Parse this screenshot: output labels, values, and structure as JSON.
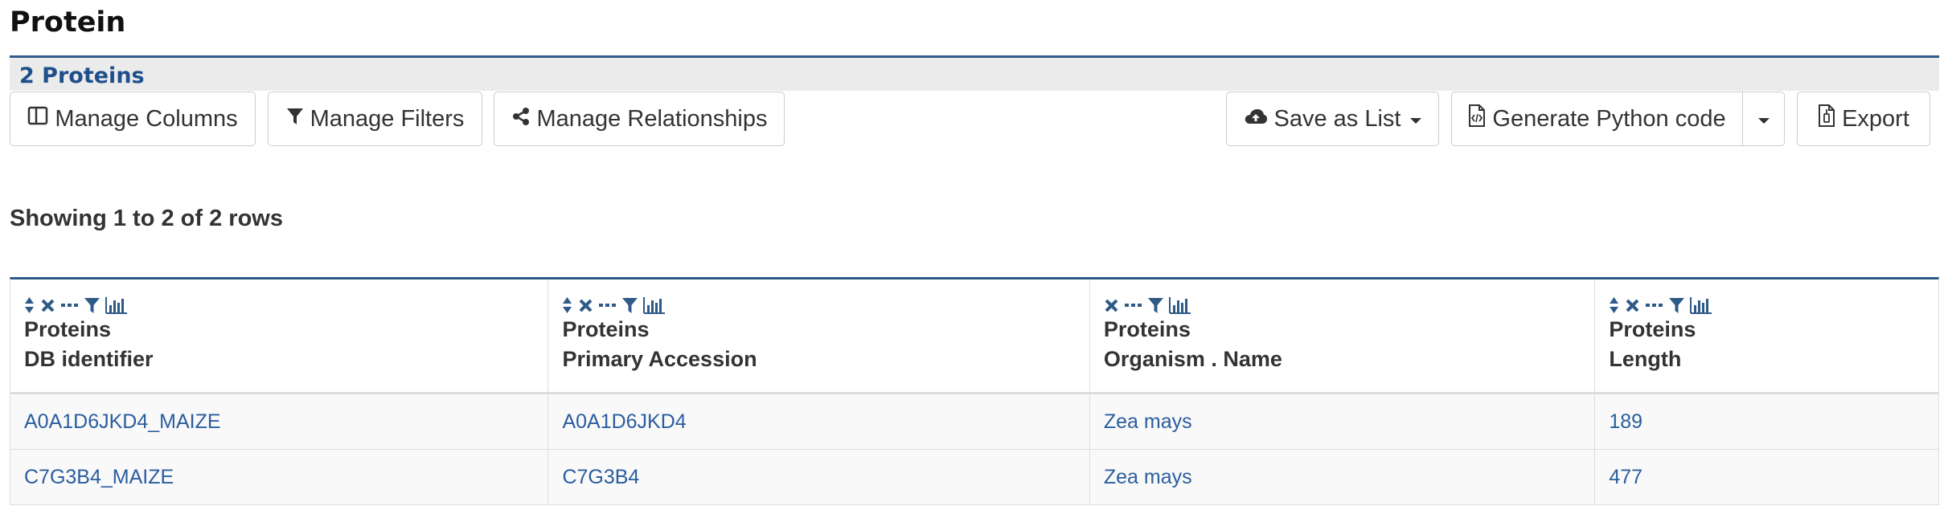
{
  "page": {
    "title": "Protein"
  },
  "results": {
    "count_label": "2 Proteins"
  },
  "toolbar": {
    "manage_columns": "Manage Columns",
    "manage_filters": "Manage Filters",
    "manage_relationships": "Manage Relationships",
    "save_as_list": "Save as List",
    "generate_code": "Generate Python code",
    "export": "Export"
  },
  "table": {
    "showing": "Showing 1 to 2 of 2 rows",
    "columns": [
      {
        "line1": "Proteins",
        "line2": "DB identifier",
        "icons": [
          "sort-icon",
          "remove-icon",
          "summary-icon",
          "filter-icon",
          "chart-icon"
        ]
      },
      {
        "line1": "Proteins",
        "line2": "Primary Accession",
        "icons": [
          "sort-icon",
          "remove-icon",
          "summary-icon",
          "filter-icon",
          "chart-icon"
        ]
      },
      {
        "line1": "Proteins",
        "line2": "Organism . Name",
        "icons": [
          "remove-icon",
          "summary-icon",
          "filter-icon",
          "chart-icon"
        ]
      },
      {
        "line1": "Proteins",
        "line2": "Length",
        "icons": [
          "sort-icon",
          "remove-icon",
          "summary-icon",
          "filter-icon",
          "chart-icon"
        ]
      }
    ],
    "rows": [
      [
        "A0A1D6JKD4_MAIZE",
        "A0A1D6JKD4",
        "Zea mays",
        "189"
      ],
      [
        "C7G3B4_MAIZE",
        "C7G3B4",
        "Zea mays",
        "477"
      ]
    ]
  },
  "colors": {
    "accent": "#2e5a88",
    "link": "#2a5d9f",
    "header_band": "#ebebeb"
  }
}
